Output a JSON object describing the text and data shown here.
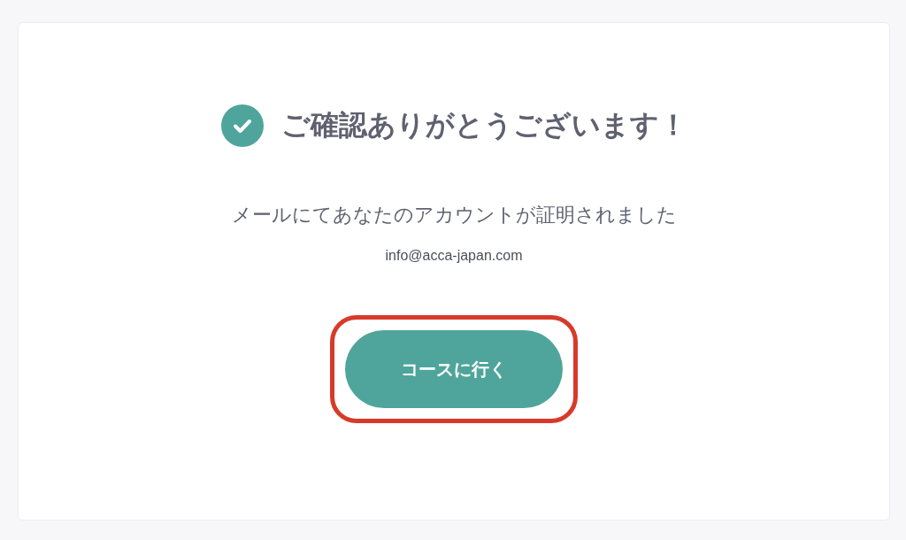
{
  "confirmation": {
    "title": "ご確認ありがとうございます！",
    "message": "メールにてあなたのアカウントが証明されました",
    "email": "info@acca-japan.com",
    "button": {
      "label": "コースに行く",
      "highlighted": true
    }
  }
}
